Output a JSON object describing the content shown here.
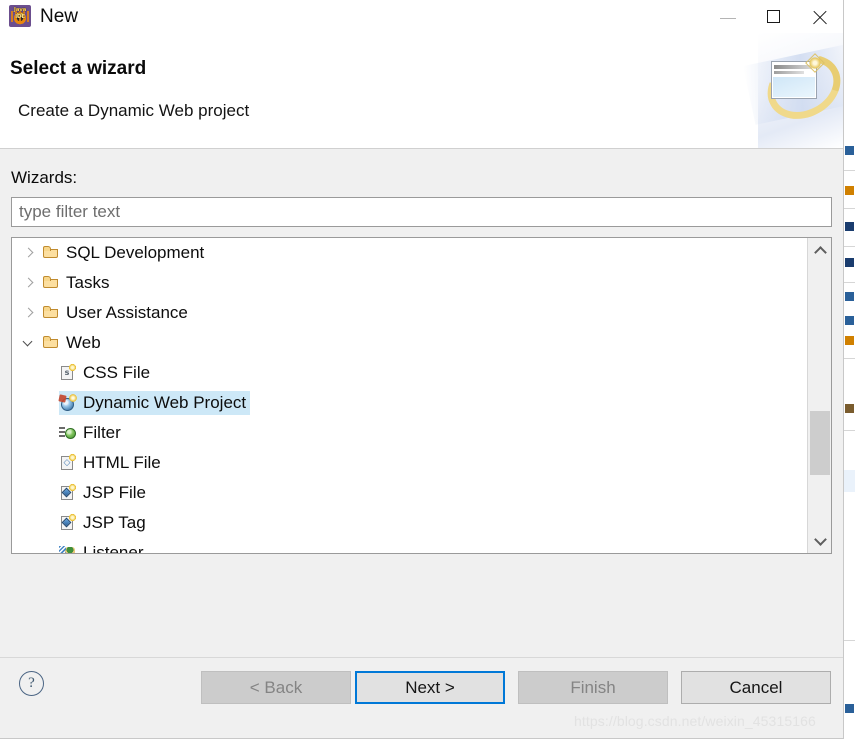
{
  "window": {
    "title": "New",
    "icon": "eclipse-javaee-ide-icon",
    "icon_text_top": "Java EE",
    "icon_text_bottom": "IDE",
    "controls": {
      "minimize": "minimize-icon",
      "maximize": "maximize-icon",
      "close": "close-icon"
    }
  },
  "header": {
    "title": "Select a wizard",
    "description": "Create a Dynamic Web project",
    "banner_icon": "wizard-banner-icon"
  },
  "body": {
    "wizards_label": "Wizards:",
    "filter": {
      "value": "",
      "placeholder": "type filter text"
    },
    "tree": [
      {
        "label": "SQL Development",
        "icon": "folder-icon",
        "level": 0,
        "expanded": false,
        "has_children": true,
        "selected": false
      },
      {
        "label": "Tasks",
        "icon": "folder-icon",
        "level": 0,
        "expanded": false,
        "has_children": true,
        "selected": false
      },
      {
        "label": "User Assistance",
        "icon": "folder-icon",
        "level": 0,
        "expanded": false,
        "has_children": true,
        "selected": false
      },
      {
        "label": "Web",
        "icon": "folder-icon",
        "level": 0,
        "expanded": true,
        "has_children": true,
        "selected": false
      },
      {
        "label": "CSS File",
        "icon": "css-file-icon",
        "level": 1,
        "expanded": false,
        "has_children": false,
        "selected": false
      },
      {
        "label": "Dynamic Web Project",
        "icon": "dynamic-web-project-icon",
        "level": 1,
        "expanded": false,
        "has_children": false,
        "selected": true
      },
      {
        "label": "Filter",
        "icon": "filter-icon",
        "level": 1,
        "expanded": false,
        "has_children": false,
        "selected": false
      },
      {
        "label": "HTML File",
        "icon": "html-file-icon",
        "level": 1,
        "expanded": false,
        "has_children": false,
        "selected": false
      },
      {
        "label": "JSP File",
        "icon": "jsp-file-icon",
        "level": 1,
        "expanded": false,
        "has_children": false,
        "selected": false
      },
      {
        "label": "JSP Tag",
        "icon": "jsp-tag-icon",
        "level": 1,
        "expanded": false,
        "has_children": false,
        "selected": false
      },
      {
        "label": "Listener",
        "icon": "listener-icon",
        "level": 1,
        "expanded": false,
        "has_children": false,
        "selected": false
      }
    ],
    "scrollbar": {
      "up_icon": "chevron-up-icon",
      "down_icon": "chevron-down-icon"
    }
  },
  "footer": {
    "help_label": "?",
    "buttons": {
      "back": "< Back",
      "next": "Next >",
      "finish": "Finish",
      "cancel": "Cancel"
    }
  },
  "watermark": "https://blog.csdn.net/weixin_45315166",
  "colors": {
    "accent": "#0078d7",
    "selection": "#cde8f7",
    "dialog_bg": "#f0f0f0",
    "field_bg": "#ffffff"
  }
}
